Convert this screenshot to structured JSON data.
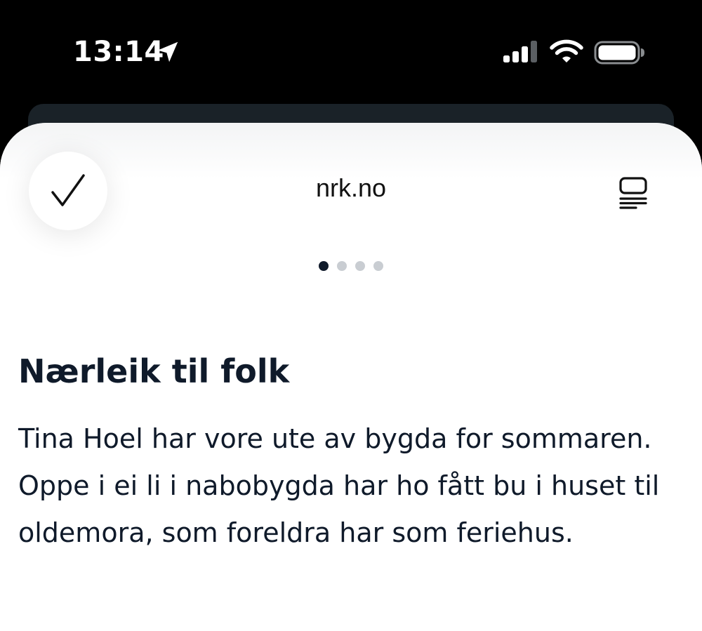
{
  "status_bar": {
    "time": "13:14",
    "location_icon": "location-arrow-icon",
    "signal_icon": "cellular-signal-icon",
    "wifi_icon": "wifi-icon",
    "battery_icon": "battery-icon",
    "signal_bars_active": 3,
    "signal_bars_total": 4
  },
  "sheet": {
    "done_icon": "checkmark-icon",
    "site_title": "nrk.no",
    "reader_icon": "reader-mode-icon",
    "page_dots": {
      "total": 4,
      "active_index": 0
    }
  },
  "article": {
    "headline": "Nærleik til folk",
    "body": "Tina Hoel har vore ute av bygda for sommaren. Oppe i ei li i nabobygda har ho fått bu i huset til oldemora, som foreldra har som feriehus."
  },
  "colors": {
    "status_bar_bg": "#000000",
    "sheet_bg": "#ffffff",
    "text_primary": "#0f1a2a",
    "dot_active": "#0f1a2a",
    "dot_inactive": "#c9cdd2"
  }
}
